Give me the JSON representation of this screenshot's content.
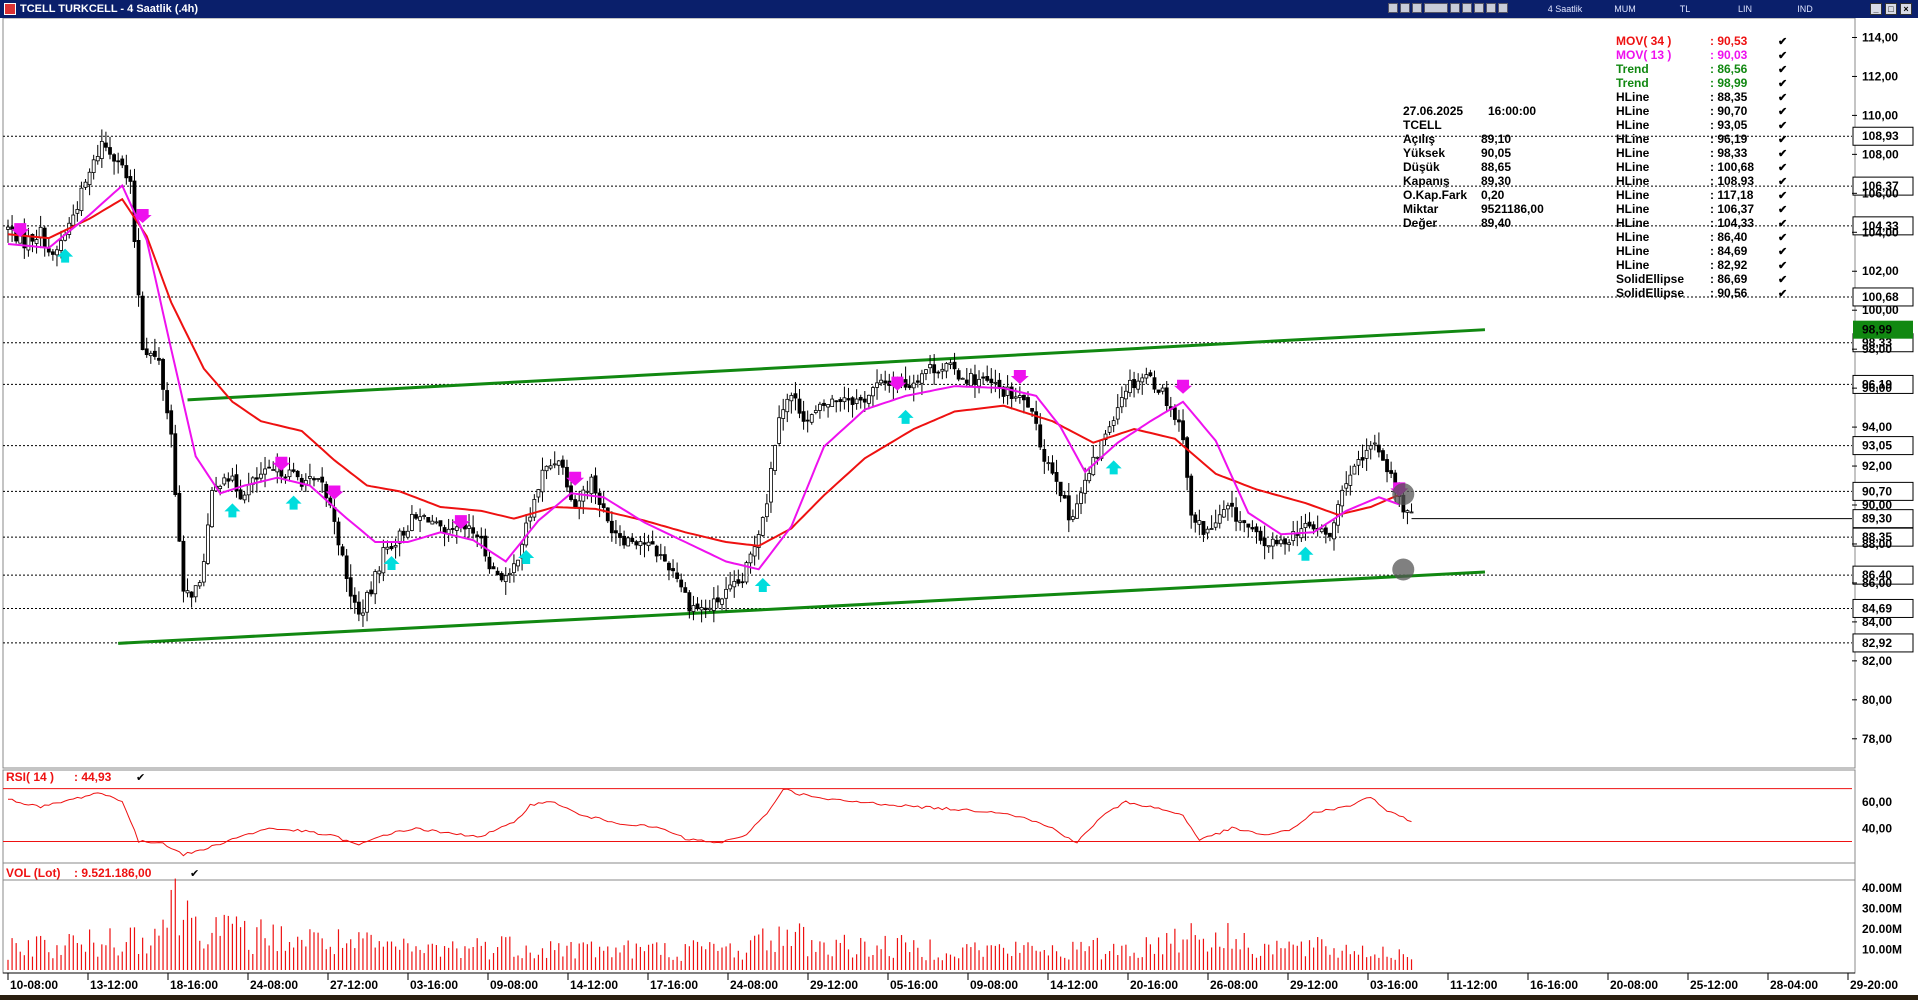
{
  "window": {
    "title": "TCELL TURKCELL - 4 Saatlik (.4h)",
    "toolbar_tooltip": "Turkcell",
    "modes": [
      "4 Saatlik",
      "MUM",
      "TL",
      "LIN",
      "IND"
    ]
  },
  "colors": {
    "up_candle": "#ffffff",
    "down_candle": "#000000",
    "mov34": "#ee1111",
    "mov13": "#ee11ee",
    "trend": "#118811",
    "hline": "#000000",
    "rsi": "#ee1111",
    "volume": "#ee1111",
    "buy_arrow": "#00dddd",
    "sell_arrow": "#ee11ee"
  },
  "info_box": {
    "datetime": [
      "27.06.2025",
      "16:00:00"
    ],
    "symbol": "TCELL",
    "rows": [
      {
        "label": "Açılış",
        "value": "89,10"
      },
      {
        "label": "Yüksek",
        "value": "90,05"
      },
      {
        "label": "Düşük",
        "value": "88,65"
      },
      {
        "label": "Kapanış",
        "value": "89,30"
      },
      {
        "label": "O.Kap.Fark",
        "value": "0,20"
      },
      {
        "label": "Miktar",
        "value": "9521186,00"
      },
      {
        "label": "Değer",
        "value": "89,40"
      }
    ]
  },
  "legend": [
    {
      "label": "MOV( 34 )",
      "value": ": 90,53",
      "color": "#ee1111"
    },
    {
      "label": "MOV( 13 )",
      "value": ": 90,03",
      "color": "#ee11ee"
    },
    {
      "label": "Trend",
      "value": ": 86,56",
      "color": "#118811"
    },
    {
      "label": "Trend",
      "value": ": 98,99",
      "color": "#118811"
    },
    {
      "label": "HLine",
      "value": ": 88,35",
      "color": "#000000"
    },
    {
      "label": "HLine",
      "value": ": 90,70",
      "color": "#000000"
    },
    {
      "label": "HLine",
      "value": ": 93,05",
      "color": "#000000"
    },
    {
      "label": "HLine",
      "value": ": 96,19",
      "color": "#000000"
    },
    {
      "label": "HLine",
      "value": ": 98,33",
      "color": "#000000"
    },
    {
      "label": "HLine",
      "value": ": 100,68",
      "color": "#000000"
    },
    {
      "label": "HLine",
      "value": ": 108,93",
      "color": "#000000"
    },
    {
      "label": "HLine",
      "value": ": 117,18",
      "color": "#000000"
    },
    {
      "label": "HLine",
      "value": ": 106,37",
      "color": "#000000"
    },
    {
      "label": "HLine",
      "value": ": 104,33",
      "color": "#000000"
    },
    {
      "label": "HLine",
      "value": ": 86,40",
      "color": "#000000"
    },
    {
      "label": "HLine",
      "value": ": 84,69",
      "color": "#000000"
    },
    {
      "label": "HLine",
      "value": ": 82,92",
      "color": "#000000"
    },
    {
      "label": "SolidEllipse",
      "value": ": 86,69",
      "color": "#000000"
    },
    {
      "label": "SolidEllipse",
      "value": ": 90,56",
      "color": "#000000"
    }
  ],
  "chart_data": [
    {
      "type": "candlestick",
      "title": "TCELL TURKCELL - 4 Saatlik (.4h)",
      "price_axis_ticks": [
        "114,00",
        "112,00",
        "110,00",
        "108,00",
        "106,00",
        "104,00",
        "102,00",
        "100,00",
        "98,00",
        "96,00",
        "94,00",
        "92,00",
        "90,00",
        "88,00",
        "86,00",
        "84,00",
        "82,00",
        "80,00",
        "78,00"
      ],
      "price_axis_range": [
        76.5,
        115.0
      ],
      "x_tick_labels": [
        "10-08:00",
        "13-12:00",
        "18-16:00",
        "24-08:00",
        "27-12:00",
        "03-16:00",
        "09-08:00",
        "14-12:00",
        "17-16:00",
        "24-08:00",
        "29-12:00",
        "05-16:00",
        "09-08:00",
        "14-12:00",
        "20-16:00",
        "26-08:00",
        "29-12:00",
        "03-16:00",
        "11-12:00",
        "16-16:00",
        "20-08:00",
        "25-12:00",
        "28-04:00",
        "29-20:00"
      ],
      "hlines": [
        {
          "value": 108.93,
          "label": "108,93"
        },
        {
          "value": 106.37,
          "label": "106,37"
        },
        {
          "value": 104.33,
          "label": "104,33"
        },
        {
          "value": 100.68,
          "label": "100,68"
        },
        {
          "value": 98.33,
          "label": "98,33"
        },
        {
          "value": 96.19,
          "label": "96,19"
        },
        {
          "value": 93.05,
          "label": "93,05"
        },
        {
          "value": 90.7,
          "label": "90,70"
        },
        {
          "value": 88.35,
          "label": "88,35"
        },
        {
          "value": 86.4,
          "label": "86,40"
        },
        {
          "value": 84.69,
          "label": "84,69"
        },
        {
          "value": 82.92,
          "label": "82,92"
        }
      ],
      "last_price": {
        "value": 89.3,
        "label": "89,30"
      },
      "trend_label": "98,99",
      "trendlines": [
        {
          "name": "Trend",
          "from": {
            "bar": 44,
            "price": 95.4
          },
          "to": {
            "bar": 362,
            "price": 99.0
          }
        },
        {
          "name": "Trend",
          "from": {
            "bar": 27,
            "price": 82.9
          },
          "to": {
            "bar": 362,
            "price": 86.56
          }
        }
      ],
      "solid_ellipses": [
        {
          "bar": 341,
          "price": 90.56
        },
        {
          "bar": 341,
          "price": 86.69
        }
      ],
      "candle_anchors": [
        [
          0,
          104.2
        ],
        [
          4,
          103.5
        ],
        [
          8,
          104.0
        ],
        [
          11,
          102.6
        ],
        [
          15,
          104.4
        ],
        [
          20,
          107.0
        ],
        [
          23,
          108.6
        ],
        [
          27,
          107.8
        ],
        [
          30,
          106.3
        ],
        [
          33,
          98.2
        ],
        [
          37,
          97.3
        ],
        [
          40,
          93.6
        ],
        [
          43,
          85.3
        ],
        [
          47,
          85.8
        ],
        [
          50,
          90.4
        ],
        [
          53,
          91.7
        ],
        [
          57,
          90.6
        ],
        [
          62,
          91.5
        ],
        [
          67,
          91.8
        ],
        [
          72,
          91.3
        ],
        [
          77,
          91.0
        ],
        [
          80,
          89.3
        ],
        [
          83,
          86.1
        ],
        [
          86,
          84.3
        ],
        [
          89,
          85.6
        ],
        [
          92,
          87.6
        ],
        [
          96,
          88.4
        ],
        [
          99,
          89.2
        ],
        [
          103,
          89.4
        ],
        [
          107,
          88.3
        ],
        [
          111,
          88.8
        ],
        [
          115,
          88.5
        ],
        [
          119,
          86.6
        ],
        [
          123,
          86.2
        ],
        [
          127,
          88.8
        ],
        [
          131,
          91.6
        ],
        [
          135,
          92.5
        ],
        [
          139,
          90.0
        ],
        [
          143,
          91.3
        ],
        [
          147,
          89.1
        ],
        [
          151,
          88.3
        ],
        [
          155,
          88.2
        ],
        [
          159,
          87.6
        ],
        [
          164,
          86.4
        ],
        [
          167,
          84.9
        ],
        [
          171,
          84.6
        ],
        [
          174,
          85.1
        ],
        [
          177,
          85.6
        ],
        [
          180,
          86.1
        ],
        [
          183,
          88.0
        ],
        [
          186,
          90.3
        ],
        [
          189,
          94.8
        ],
        [
          192,
          95.6
        ],
        [
          196,
          94.3
        ],
        [
          200,
          95.1
        ],
        [
          205,
          95.6
        ],
        [
          209,
          95.3
        ],
        [
          213,
          96.1
        ],
        [
          217,
          96.4
        ],
        [
          221,
          96.2
        ],
        [
          225,
          97.0
        ],
        [
          230,
          97.1
        ],
        [
          234,
          96.6
        ],
        [
          238,
          96.4
        ],
        [
          242,
          96.1
        ],
        [
          246,
          95.6
        ],
        [
          250,
          95.2
        ],
        [
          254,
          92.5
        ],
        [
          257,
          91.5
        ],
        [
          260,
          89.3
        ],
        [
          263,
          90.6
        ],
        [
          266,
          92.1
        ],
        [
          270,
          94.2
        ],
        [
          274,
          96.1
        ],
        [
          279,
          96.7
        ],
        [
          283,
          95.8
        ],
        [
          288,
          93.7
        ],
        [
          290,
          89.3
        ],
        [
          294,
          88.6
        ],
        [
          299,
          89.8
        ],
        [
          303,
          89.0
        ],
        [
          307,
          88.1
        ],
        [
          311,
          87.9
        ],
        [
          316,
          88.7
        ],
        [
          320,
          88.9
        ],
        [
          324,
          88.3
        ],
        [
          328,
          91.4
        ],
        [
          332,
          92.2
        ],
        [
          335,
          93.3
        ],
        [
          338,
          92.0
        ],
        [
          341,
          90.2
        ],
        [
          344,
          89.3
        ]
      ],
      "mov34_anchors": [
        [
          0,
          103.9
        ],
        [
          10,
          103.7
        ],
        [
          20,
          104.7
        ],
        [
          28,
          105.7
        ],
        [
          34,
          103.8
        ],
        [
          40,
          100.4
        ],
        [
          48,
          97.0
        ],
        [
          55,
          95.3
        ],
        [
          62,
          94.3
        ],
        [
          72,
          93.8
        ],
        [
          80,
          92.3
        ],
        [
          88,
          91.0
        ],
        [
          96,
          90.7
        ],
        [
          106,
          89.9
        ],
        [
          116,
          89.7
        ],
        [
          124,
          89.3
        ],
        [
          134,
          89.9
        ],
        [
          144,
          89.8
        ],
        [
          156,
          89.2
        ],
        [
          166,
          88.6
        ],
        [
          176,
          88.1
        ],
        [
          184,
          87.9
        ],
        [
          192,
          88.8
        ],
        [
          200,
          90.5
        ],
        [
          210,
          92.4
        ],
        [
          222,
          93.9
        ],
        [
          232,
          94.8
        ],
        [
          244,
          95.1
        ],
        [
          256,
          94.3
        ],
        [
          266,
          93.2
        ],
        [
          276,
          93.9
        ],
        [
          286,
          93.4
        ],
        [
          296,
          91.6
        ],
        [
          306,
          90.8
        ],
        [
          318,
          90.1
        ],
        [
          326,
          89.5
        ],
        [
          334,
          89.9
        ],
        [
          341,
          90.53
        ]
      ],
      "mov13_anchors": [
        [
          0,
          103.4
        ],
        [
          10,
          103.2
        ],
        [
          20,
          104.9
        ],
        [
          28,
          106.4
        ],
        [
          34,
          103.6
        ],
        [
          40,
          98.0
        ],
        [
          46,
          92.5
        ],
        [
          52,
          90.6
        ],
        [
          58,
          91.0
        ],
        [
          66,
          91.4
        ],
        [
          74,
          91.0
        ],
        [
          82,
          89.5
        ],
        [
          90,
          88.1
        ],
        [
          98,
          88.1
        ],
        [
          106,
          88.6
        ],
        [
          114,
          88.2
        ],
        [
          122,
          87.1
        ],
        [
          130,
          89.2
        ],
        [
          138,
          90.6
        ],
        [
          146,
          90.4
        ],
        [
          156,
          89.1
        ],
        [
          166,
          88.1
        ],
        [
          176,
          87.1
        ],
        [
          184,
          86.7
        ],
        [
          192,
          88.9
        ],
        [
          200,
          93.0
        ],
        [
          210,
          94.9
        ],
        [
          220,
          95.6
        ],
        [
          232,
          96.1
        ],
        [
          244,
          96.0
        ],
        [
          252,
          95.6
        ],
        [
          258,
          94.0
        ],
        [
          264,
          91.7
        ],
        [
          272,
          93.2
        ],
        [
          280,
          94.3
        ],
        [
          288,
          95.3
        ],
        [
          296,
          93.3
        ],
        [
          304,
          89.6
        ],
        [
          312,
          88.5
        ],
        [
          320,
          88.6
        ],
        [
          328,
          89.7
        ],
        [
          336,
          90.4
        ],
        [
          341,
          90.03
        ]
      ],
      "volume_anchors": [
        [
          0,
          14
        ],
        [
          20,
          16
        ],
        [
          37,
          24
        ],
        [
          40,
          41
        ],
        [
          44,
          34
        ],
        [
          55,
          22
        ],
        [
          80,
          17
        ],
        [
          100,
          12
        ],
        [
          120,
          15
        ],
        [
          140,
          13
        ],
        [
          160,
          12
        ],
        [
          180,
          13
        ],
        [
          190,
          22
        ],
        [
          200,
          15
        ],
        [
          230,
          13
        ],
        [
          260,
          12
        ],
        [
          280,
          14
        ],
        [
          288,
          23
        ],
        [
          310,
          14
        ],
        [
          330,
          12
        ],
        [
          344,
          9.5
        ]
      ]
    },
    {
      "type": "line",
      "title": "RSI( 14 )",
      "value_label": ": 44,93",
      "y_ticks": [
        "60,00",
        "40,00"
      ],
      "y_range": [
        16,
        72
      ],
      "levels": [
        70,
        30
      ],
      "anchors": [
        [
          0,
          62
        ],
        [
          8,
          56
        ],
        [
          16,
          62
        ],
        [
          22,
          67
        ],
        [
          28,
          61
        ],
        [
          32,
          30
        ],
        [
          38,
          29
        ],
        [
          43,
          20
        ],
        [
          48,
          24
        ],
        [
          56,
          33
        ],
        [
          64,
          40
        ],
        [
          72,
          38
        ],
        [
          80,
          34
        ],
        [
          86,
          27
        ],
        [
          92,
          35
        ],
        [
          100,
          40
        ],
        [
          108,
          36
        ],
        [
          116,
          34
        ],
        [
          124,
          44
        ],
        [
          128,
          58
        ],
        [
          134,
          60
        ],
        [
          140,
          50
        ],
        [
          150,
          44
        ],
        [
          160,
          40
        ],
        [
          166,
          32
        ],
        [
          174,
          29
        ],
        [
          180,
          33
        ],
        [
          186,
          51
        ],
        [
          190,
          70
        ],
        [
          194,
          66
        ],
        [
          200,
          62
        ],
        [
          208,
          60
        ],
        [
          216,
          58
        ],
        [
          224,
          56
        ],
        [
          234,
          54
        ],
        [
          244,
          52
        ],
        [
          250,
          47
        ],
        [
          256,
          40
        ],
        [
          262,
          29
        ],
        [
          268,
          49
        ],
        [
          274,
          60
        ],
        [
          282,
          55
        ],
        [
          288,
          50
        ],
        [
          292,
          31
        ],
        [
          300,
          40
        ],
        [
          308,
          35
        ],
        [
          314,
          38
        ],
        [
          320,
          52
        ],
        [
          328,
          56
        ],
        [
          334,
          64
        ],
        [
          338,
          53
        ],
        [
          344,
          45
        ]
      ]
    },
    {
      "type": "bar",
      "title": "VOL (Lot)",
      "value_label": ": 9.521.186,00",
      "y_ticks": [
        "40.00M",
        "30.00M",
        "20.00M",
        "10.00M"
      ],
      "y_range": [
        0,
        44
      ],
      "unit": "M lot"
    }
  ]
}
